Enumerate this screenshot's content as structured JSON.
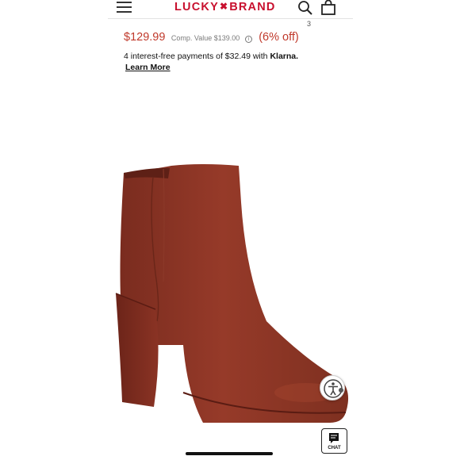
{
  "header": {
    "brand_left": "LUCKY",
    "brand_right": "BRAND",
    "bag_count": "3"
  },
  "product": {
    "price": "$129.99",
    "comp_value": "Comp. Value $139.00",
    "info_symbol": "i",
    "discount": "(6% off)",
    "klarna_text": "4 interest-free payments of $32.49 with",
    "klarna_brand": "Klarna.",
    "learn_more": "Learn More",
    "image_color": "#8e3626"
  },
  "chat": {
    "label": "CHAT"
  },
  "colors": {
    "brand": "#c8102e",
    "price": "#c0392b"
  }
}
